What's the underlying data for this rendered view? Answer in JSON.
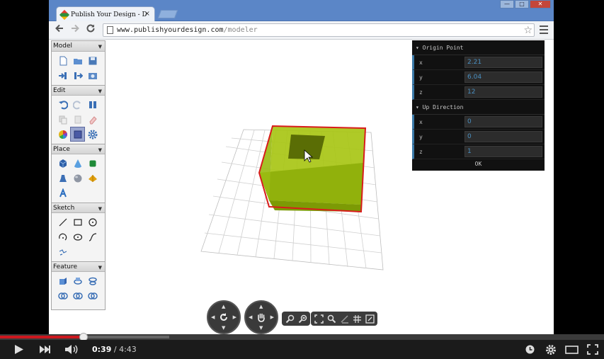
{
  "browser": {
    "tab_title": "Publish Your Design - D",
    "tab_close": "×",
    "address_host": "www.publishyourdesign.com",
    "address_path": "/modeler",
    "win_min": "—",
    "win_max": "□",
    "win_close": "✕"
  },
  "palette": {
    "groups": [
      {
        "label": "Model",
        "tools": [
          "new-file-icon",
          "open-folder-icon",
          "save-icon",
          "import-icon",
          "export-icon",
          "snapshot-icon"
        ]
      },
      {
        "label": "Edit",
        "tools": [
          "undo-icon",
          "redo-icon",
          "pause-icon",
          "copy-icon",
          "paste-icon",
          "eraser-icon",
          "color-wheel-icon",
          "select-box-icon",
          "gear-icon"
        ]
      },
      {
        "label": "Place",
        "tools": [
          "cube-icon",
          "cone-icon",
          "cylinder-icon",
          "bell-icon",
          "sphere-icon",
          "pyramid-icon",
          "text-a-icon"
        ]
      },
      {
        "label": "Sketch",
        "tools": [
          "line-icon",
          "rectangle-icon",
          "circle-icon",
          "arc-icon",
          "ellipse-icon",
          "spline-icon",
          "polyline-icon"
        ]
      },
      {
        "label": "Feature",
        "tools": [
          "extrude-icon",
          "revolve-icon",
          "loft-icon",
          "union-icon",
          "subtract-icon",
          "intersect-icon"
        ]
      }
    ]
  },
  "properties": {
    "origin_header": "▾ Origin Point",
    "origin": [
      {
        "label": "x",
        "value": "2.21"
      },
      {
        "label": "y",
        "value": "6.04"
      },
      {
        "label": "z",
        "value": "12"
      }
    ],
    "up_header": "▾ Up Direction",
    "up": [
      {
        "label": "x",
        "value": "0"
      },
      {
        "label": "y",
        "value": "0"
      },
      {
        "label": "z",
        "value": "1"
      }
    ],
    "ok_label": "OK"
  },
  "colors": {
    "accent_red": "#cc181e",
    "model_green": "#9fbe0c",
    "selection_outline": "#d81c1c",
    "input_text": "#4a8fc0"
  },
  "player": {
    "current_time": "0:39",
    "separator": " / ",
    "duration": "4:43",
    "played_fraction": 0.1378,
    "buffered_fraction": 0.28
  }
}
